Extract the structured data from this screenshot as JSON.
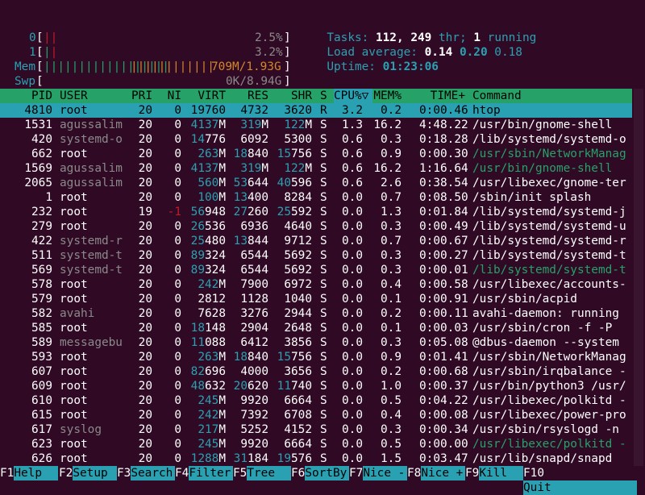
{
  "meters": {
    "cpu0": {
      "label": "0",
      "percent": "2.5%",
      "bar": "||"
    },
    "cpu1": {
      "label": "1",
      "percent": "3.2%",
      "bar": "||"
    },
    "mem": {
      "label": "Mem",
      "bar_green": "||||||||||||||||||",
      "bar_orange": "||||||||||||",
      "value": "709M/1.93G"
    },
    "swp": {
      "label": "Swp",
      "value": "0K/8.94G"
    }
  },
  "summary": {
    "tasks_label": "Tasks:",
    "tasks": "112,",
    "threads": "249",
    "threads_label": "thr;",
    "running": "1",
    "running_label": "running",
    "load_label": "Load average:",
    "load1": "0.14",
    "load5": "0.20",
    "load15": "0.18",
    "uptime_label": "Uptime:",
    "uptime": "01:23:06"
  },
  "columns": [
    "PID",
    "USER",
    "PRI",
    "NI",
    "VIRT",
    "RES",
    "SHR",
    "S",
    "CPU%▽",
    "MEM%",
    "TIME+",
    "Command"
  ],
  "processes": [
    {
      "pid": "4810",
      "user": "root",
      "pri": "20",
      "ni": "0",
      "virt": "19760",
      "res": "4732",
      "shr": "3620",
      "s": "R",
      "cpu": "3.2",
      "mem": "0.2",
      "time": "0:00.46",
      "cmd": "htop"
    },
    {
      "pid": "1531",
      "user": "agussalim",
      "pri": "20",
      "ni": "0",
      "virt": "4137M",
      "res": "319M",
      "shr": "122M",
      "s": "S",
      "cpu": "1.3",
      "mem": "16.2",
      "time": "4:48.22",
      "cmd": "/usr/bin/gnome-shell"
    },
    {
      "pid": "420",
      "user": "systemd-o",
      "pri": "20",
      "ni": "0",
      "virt": "14776",
      "res": "6092",
      "shr": "5300",
      "s": "S",
      "cpu": "0.6",
      "mem": "0.3",
      "time": "0:18.28",
      "cmd": "/lib/systemd/systemd-o"
    },
    {
      "pid": "662",
      "user": "root",
      "pri": "20",
      "ni": "0",
      "virt": "263M",
      "res": "18840",
      "shr": "15756",
      "s": "S",
      "cpu": "0.6",
      "mem": "0.9",
      "time": "0:00.30",
      "cmd": "/usr/sbin/NetworkManag"
    },
    {
      "pid": "1569",
      "user": "agussalim",
      "pri": "20",
      "ni": "0",
      "virt": "4137M",
      "res": "319M",
      "shr": "122M",
      "s": "S",
      "cpu": "0.6",
      "mem": "16.2",
      "time": "1:16.64",
      "cmd": "/usr/bin/gnome-shell"
    },
    {
      "pid": "2065",
      "user": "agussalim",
      "pri": "20",
      "ni": "0",
      "virt": "560M",
      "res": "53644",
      "shr": "40596",
      "s": "S",
      "cpu": "0.6",
      "mem": "2.6",
      "time": "0:38.54",
      "cmd": "/usr/libexec/gnome-ter"
    },
    {
      "pid": "1",
      "user": "root",
      "pri": "20",
      "ni": "0",
      "virt": "100M",
      "res": "13400",
      "shr": "8284",
      "s": "S",
      "cpu": "0.0",
      "mem": "0.7",
      "time": "0:08.50",
      "cmd": "/sbin/init splash"
    },
    {
      "pid": "232",
      "user": "root",
      "pri": "19",
      "ni": "-1",
      "virt": "56948",
      "res": "27260",
      "shr": "25592",
      "s": "S",
      "cpu": "0.0",
      "mem": "1.3",
      "time": "0:01.84",
      "cmd": "/lib/systemd/systemd-j"
    },
    {
      "pid": "279",
      "user": "root",
      "pri": "20",
      "ni": "0",
      "virt": "26536",
      "res": "6936",
      "shr": "4640",
      "s": "S",
      "cpu": "0.0",
      "mem": "0.3",
      "time": "0:00.49",
      "cmd": "/lib/systemd/systemd-u"
    },
    {
      "pid": "422",
      "user": "systemd-r",
      "pri": "20",
      "ni": "0",
      "virt": "25480",
      "res": "13844",
      "shr": "9712",
      "s": "S",
      "cpu": "0.0",
      "mem": "0.7",
      "time": "0:00.67",
      "cmd": "/lib/systemd/systemd-r"
    },
    {
      "pid": "511",
      "user": "systemd-t",
      "pri": "20",
      "ni": "0",
      "virt": "89324",
      "res": "6544",
      "shr": "5692",
      "s": "S",
      "cpu": "0.0",
      "mem": "0.3",
      "time": "0:00.27",
      "cmd": "/lib/systemd/systemd-t"
    },
    {
      "pid": "569",
      "user": "systemd-t",
      "pri": "20",
      "ni": "0",
      "virt": "89324",
      "res": "6544",
      "shr": "5692",
      "s": "S",
      "cpu": "0.0",
      "mem": "0.3",
      "time": "0:00.01",
      "cmd": "/lib/systemd/systemd-t"
    },
    {
      "pid": "578",
      "user": "root",
      "pri": "20",
      "ni": "0",
      "virt": "242M",
      "res": "7900",
      "shr": "6972",
      "s": "S",
      "cpu": "0.0",
      "mem": "0.4",
      "time": "0:00.58",
      "cmd": "/usr/libexec/accounts-"
    },
    {
      "pid": "579",
      "user": "root",
      "pri": "20",
      "ni": "0",
      "virt": "2812",
      "res": "1128",
      "shr": "1040",
      "s": "S",
      "cpu": "0.0",
      "mem": "0.1",
      "time": "0:00.91",
      "cmd": "/usr/sbin/acpid"
    },
    {
      "pid": "582",
      "user": "avahi",
      "pri": "20",
      "ni": "0",
      "virt": "7628",
      "res": "3276",
      "shr": "2944",
      "s": "S",
      "cpu": "0.0",
      "mem": "0.2",
      "time": "0:00.11",
      "cmd": "avahi-daemon: running"
    },
    {
      "pid": "585",
      "user": "root",
      "pri": "20",
      "ni": "0",
      "virt": "18148",
      "res": "2904",
      "shr": "2648",
      "s": "S",
      "cpu": "0.0",
      "mem": "0.1",
      "time": "0:00.03",
      "cmd": "/usr/sbin/cron -f -P"
    },
    {
      "pid": "589",
      "user": "messagebu",
      "pri": "20",
      "ni": "0",
      "virt": "11088",
      "res": "6412",
      "shr": "3856",
      "s": "S",
      "cpu": "0.0",
      "mem": "0.3",
      "time": "0:05.08",
      "cmd": "@dbus-daemon --system"
    },
    {
      "pid": "593",
      "user": "root",
      "pri": "20",
      "ni": "0",
      "virt": "263M",
      "res": "18840",
      "shr": "15756",
      "s": "S",
      "cpu": "0.0",
      "mem": "0.9",
      "time": "0:01.41",
      "cmd": "/usr/sbin/NetworkManag"
    },
    {
      "pid": "607",
      "user": "root",
      "pri": "20",
      "ni": "0",
      "virt": "82696",
      "res": "4000",
      "shr": "3656",
      "s": "S",
      "cpu": "0.0",
      "mem": "0.2",
      "time": "0:00.68",
      "cmd": "/usr/sbin/irqbalance -"
    },
    {
      "pid": "609",
      "user": "root",
      "pri": "20",
      "ni": "0",
      "virt": "48632",
      "res": "20620",
      "shr": "11740",
      "s": "S",
      "cpu": "0.0",
      "mem": "1.0",
      "time": "0:00.37",
      "cmd": "/usr/bin/python3 /usr/"
    },
    {
      "pid": "610",
      "user": "root",
      "pri": "20",
      "ni": "0",
      "virt": "245M",
      "res": "9920",
      "shr": "6664",
      "s": "S",
      "cpu": "0.0",
      "mem": "0.5",
      "time": "0:04.22",
      "cmd": "/usr/libexec/polkitd -"
    },
    {
      "pid": "615",
      "user": "root",
      "pri": "20",
      "ni": "0",
      "virt": "242M",
      "res": "7392",
      "shr": "6708",
      "s": "S",
      "cpu": "0.0",
      "mem": "0.4",
      "time": "0:00.08",
      "cmd": "/usr/libexec/power-pro"
    },
    {
      "pid": "617",
      "user": "syslog",
      "pri": "20",
      "ni": "0",
      "virt": "217M",
      "res": "5252",
      "shr": "4152",
      "s": "S",
      "cpu": "0.0",
      "mem": "0.3",
      "time": "0:00.34",
      "cmd": "/usr/sbin/rsyslogd -n"
    },
    {
      "pid": "623",
      "user": "root",
      "pri": "20",
      "ni": "0",
      "virt": "245M",
      "res": "9920",
      "shr": "6664",
      "s": "S",
      "cpu": "0.0",
      "mem": "0.5",
      "time": "0:00.00",
      "cmd": "/usr/libexec/polkitd -"
    },
    {
      "pid": "626",
      "user": "root",
      "pri": "20",
      "ni": "0",
      "virt": "1288M",
      "res": "31184",
      "shr": "19576",
      "s": "S",
      "cpu": "0.0",
      "mem": "1.5",
      "time": "0:03.47",
      "cmd": "/usr/lib/snapd/snapd"
    }
  ],
  "function_keys": [
    {
      "key": "F1",
      "label": "Help"
    },
    {
      "key": "F2",
      "label": "Setup"
    },
    {
      "key": "F3",
      "label": "Search"
    },
    {
      "key": "F4",
      "label": "Filter"
    },
    {
      "key": "F5",
      "label": "Tree"
    },
    {
      "key": "F6",
      "label": "SortBy"
    },
    {
      "key": "F7",
      "label": "Nice -"
    },
    {
      "key": "F8",
      "label": "Nice +"
    },
    {
      "key": "F9",
      "label": "Kill"
    },
    {
      "key": "F10",
      "label": "Quit"
    }
  ],
  "colors": {
    "background": "#300a24",
    "header": "#26a269",
    "selection": "#2aa1b3"
  }
}
